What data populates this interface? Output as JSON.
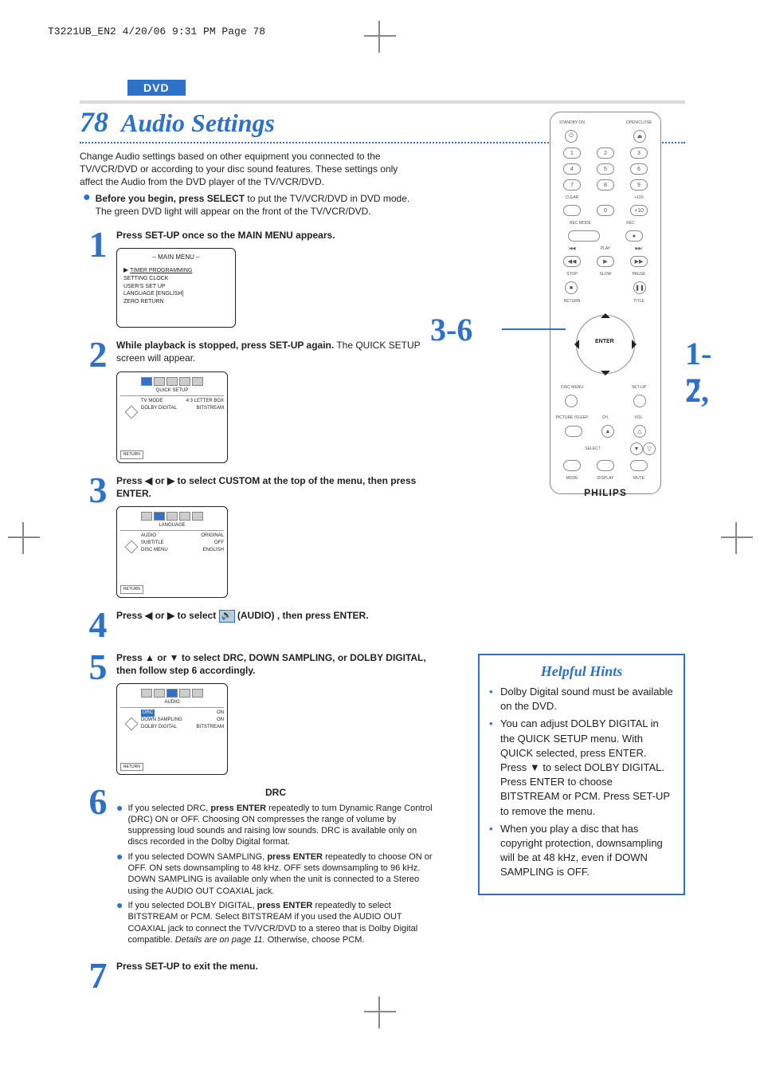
{
  "print_header": "T3221UB_EN2  4/20/06  9:31 PM  Page 78",
  "section_tag": "DVD",
  "page_number": "78",
  "page_title": "Audio Settings",
  "intro_text": "Change Audio settings based on other equipment you connected to the TV/VCR/DVD or according to your disc sound features.  These settings only affect the Audio from the DVD player of the TV/VCR/DVD.",
  "intro_bullet_bold": "Before you begin, press SELECT",
  "intro_bullet_rest": " to put the TV/VCR/DVD in DVD mode.  The green DVD light will appear on the front of the TV/VCR/DVD.",
  "steps": {
    "s1": {
      "num": "1",
      "text_bold": "Press SET-UP once so the MAIN MENU appears.",
      "menu_title": "– MAIN MENU –",
      "menu_items": [
        "TIMER PROGRAMMING",
        "SETTING CLOCK",
        "USER'S SET UP",
        "LANGUAGE  [ENGLISH]",
        "ZERO RETURN"
      ]
    },
    "s2": {
      "num": "2",
      "text_bold": "While playback is stopped, press SET-UP again.",
      "text_rest": " The QUICK SETUP screen will appear.",
      "osd_tab": "QUICK SETUP",
      "osd_rows": [
        {
          "l": "TV MODE",
          "r": "4:3 LETTER BOX"
        },
        {
          "l": "DOLBY DIGITAL",
          "r": "BITSTREAM"
        }
      ]
    },
    "s3": {
      "num": "3",
      "text_a": "Press ",
      "text_b": " or ",
      "text_c": " to select CUSTOM at the top of the menu, then press ENTER.",
      "osd_tab": "LANGUAGE",
      "osd_rows": [
        {
          "l": "AUDIO",
          "r": "ORIGINAL"
        },
        {
          "l": "SUBTITLE",
          "r": "OFF"
        },
        {
          "l": "DISC MENU",
          "r": "ENGLISH"
        }
      ]
    },
    "s4": {
      "num": "4",
      "text_a": "Press ",
      "text_b": " or ",
      "text_c": " to select ",
      "text_d": " (AUDIO) , then press ENTER."
    },
    "s5": {
      "num": "5",
      "text_a": "Press ",
      "text_b": " or ",
      "text_c": " to select DRC, DOWN SAMPLING, or DOLBY DIGITAL, then follow step 6 accordingly.",
      "osd_tab": "AUDIO",
      "osd_rows": [
        {
          "l": "DRC",
          "r": "ON"
        },
        {
          "l": "DOWN SAMPLING",
          "r": "ON"
        },
        {
          "l": "DOLBY DIGITAL",
          "r": "BITSTREAM"
        }
      ]
    },
    "s6": {
      "num": "6",
      "heading": "DRC",
      "bullets": [
        {
          "a": "If you selected DRC, ",
          "b": "press ENTER",
          "c": " repeatedly to turn Dynamic Range Control (DRC) ON or OFF. Choosing ON compresses the range of volume by suppressing loud sounds and raising low sounds. DRC is available only on discs recorded in the Dolby Digital format."
        },
        {
          "a": "If you selected DOWN SAMPLING, ",
          "b": "press ENTER",
          "c": " repeatedly to choose ON or OFF. ON sets downsampling to 48 kHz. OFF sets downsampling to 96 kHz. DOWN SAMPLING is available only when the unit is connected to a Stereo using the AUDIO OUT COAXIAL jack."
        },
        {
          "a": "If you selected DOLBY DIGITAL, ",
          "b": "press ENTER",
          "c": " repeatedly to select BITSTREAM or PCM. Select BITSTREAM if you used the AUDIO OUT COAXIAL jack to connect the TV/VCR/DVD to a stereo that is Dolby Digital compatible. ",
          "i": "Details are on page 11.",
          "d": " Otherwise, choose PCM."
        }
      ]
    },
    "s7": {
      "num": "7",
      "text_bold": "Press SET-UP to exit the menu."
    }
  },
  "osd_return": "RETURN",
  "callouts": {
    "c36": "3-6",
    "c12": "1-2,",
    "c7": "7"
  },
  "hints": {
    "title": "Helpful Hints",
    "items": [
      "Dolby Digital sound must be available on the DVD.",
      "You can adjust DOLBY DIGITAL in the QUICK SETUP menu. With QUICK selected, press ENTER. Press ▼ to select DOLBY DIGITAL. Press ENTER to choose BITSTREAM or PCM. Press SET-UP to remove the menu.",
      "When you play a disc that has copyright protection, downsampling will be at 48 kHz, even if DOWN SAMPLING is OFF."
    ]
  },
  "remote": {
    "standby": "STANDBY-ON",
    "openclose": "OPEN/CLOSE",
    "nums": [
      "1",
      "2",
      "3",
      "4",
      "5",
      "6",
      "7",
      "8",
      "9",
      "0"
    ],
    "clear": "CLEAR",
    "plus100": "+100",
    "plus10": "+10",
    "recmode": "REC MODE",
    "rec": "REC",
    "prev": "|◀◀",
    "play": "PLAY",
    "next": "▶▶|",
    "rew": "◀◀",
    "playbtn": "▶",
    "ff": "▶▶",
    "stop": "STOP",
    "slow": "SLOW",
    "pause": "PAUSE",
    "stopbtn": "■",
    "pausebtn": "❚❚",
    "return": "RETURN",
    "title": "TITLE",
    "enter": "ENTER",
    "disc": "DISC MENU",
    "setup": "SET-UP",
    "picture": "PICTURE /SLEEP",
    "ch": "CH.",
    "vol": "VOL.",
    "select": "SELECT",
    "mode": "MODE",
    "display": "DISPLAY",
    "mute": "MUTE",
    "brand": "PHILIPS"
  }
}
